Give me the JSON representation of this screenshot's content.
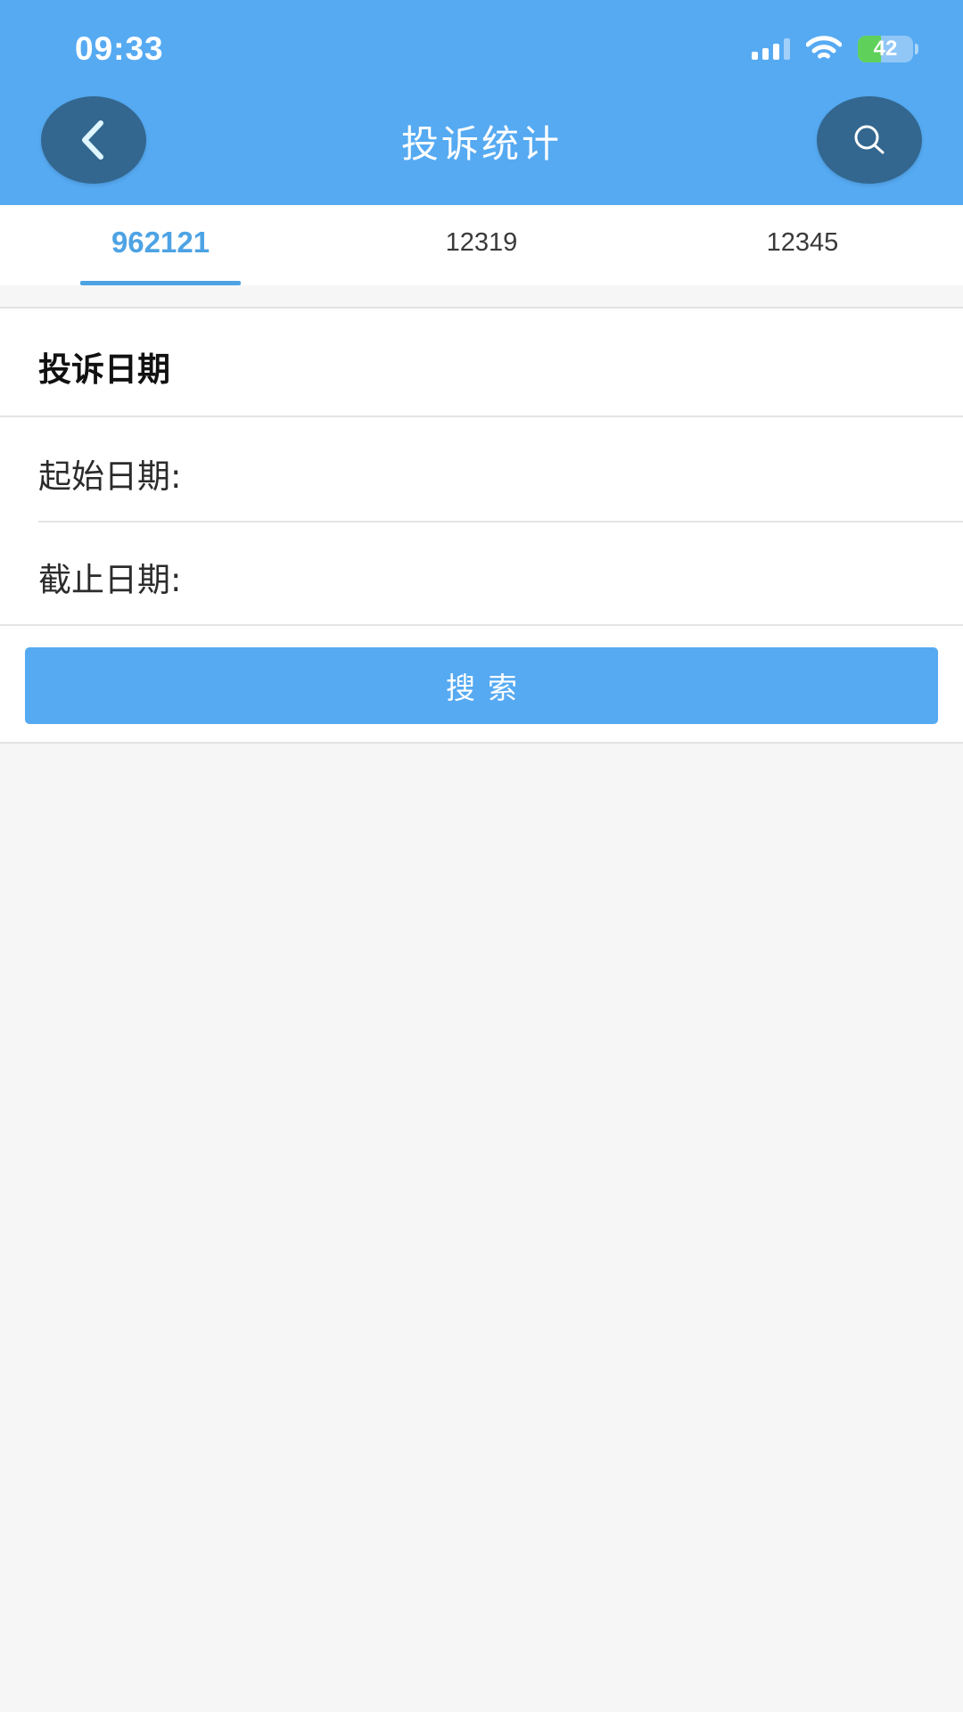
{
  "status_bar": {
    "time": "09:33",
    "battery_percent": "42",
    "battery_level": 0.42
  },
  "nav": {
    "title": "投诉统计",
    "back_icon": "chevron-left-icon",
    "search_icon": "search-icon"
  },
  "tabs": [
    {
      "label": "962121",
      "active": true
    },
    {
      "label": "12319",
      "active": false
    },
    {
      "label": "12345",
      "active": false
    }
  ],
  "form": {
    "section_title": "投诉日期",
    "start_label": "起始日期:",
    "start_value": "",
    "end_label": "截止日期:",
    "end_value": "",
    "search_button": "搜索"
  },
  "colors": {
    "header": "#56aaf2",
    "circle_button": "#33678f",
    "tab_active": "#4da3e4",
    "battery_fill": "#5fd15b",
    "background": "#f6f6f7"
  }
}
